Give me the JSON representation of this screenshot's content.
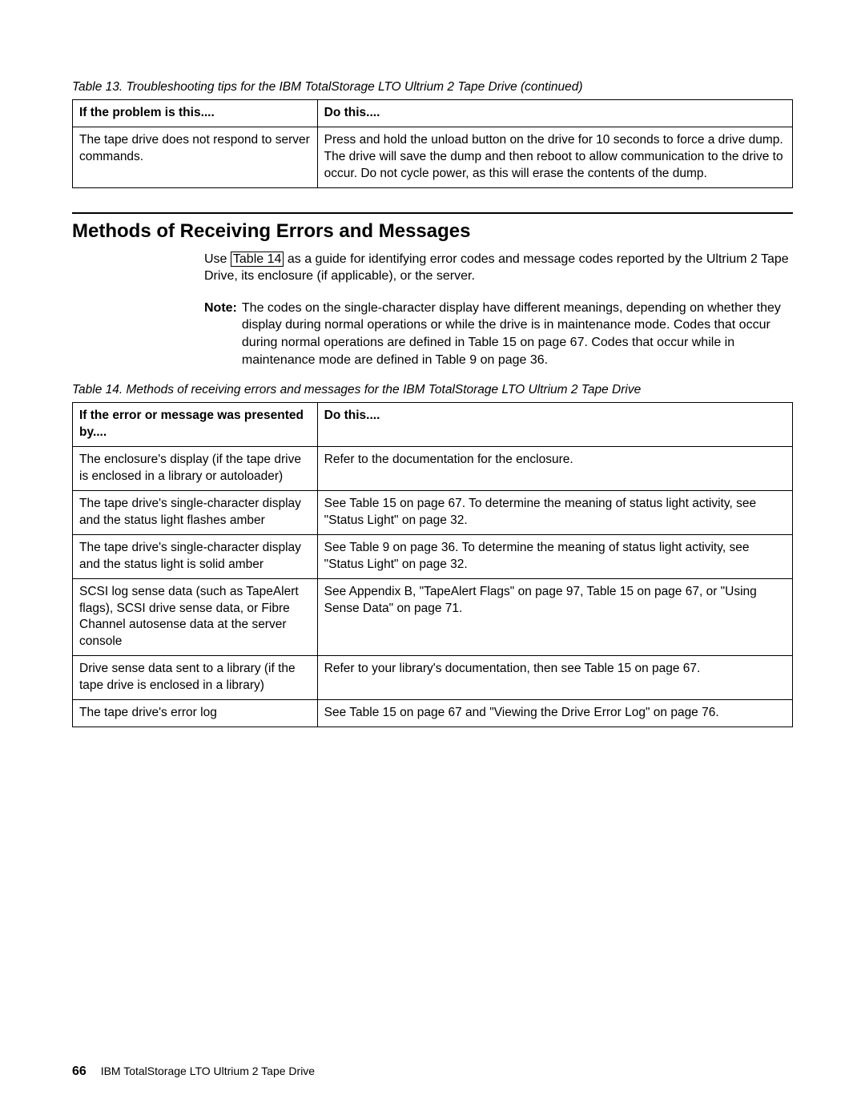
{
  "table13": {
    "caption": "Table 13. Troubleshooting tips for the IBM TotalStorage LTO Ultrium 2 Tape Drive  (continued)",
    "headers": {
      "c1": "If the problem is this....",
      "c2": "Do this...."
    },
    "rows": [
      {
        "c1": "The tape drive does not respond to server commands.",
        "c2": "Press and hold the unload button on the drive for 10 seconds to force a drive dump. The drive will save the dump and then reboot to allow communication to the drive to occur. Do not cycle power, as this will erase the contents of the dump."
      }
    ]
  },
  "section": {
    "heading": "Methods of Receiving Errors and Messages",
    "para_before_link": "Use ",
    "link_text": "Table 14",
    "para_after_link": " as a guide for identifying error codes and message codes reported by the Ultrium 2 Tape Drive, its enclosure (if applicable), or the server.",
    "note_label": "Note:",
    "note_body": "The codes on the single-character display have different meanings, depending on whether they display during normal operations or while the drive is in maintenance mode. Codes that occur during normal operations are defined in Table 15 on page 67. Codes that occur while in maintenance mode are defined in Table 9 on page 36."
  },
  "table14": {
    "caption": "Table 14. Methods of receiving errors and messages for the IBM TotalStorage LTO Ultrium 2 Tape Drive",
    "headers": {
      "c1": "If the error or message was presented by....",
      "c2": "Do this...."
    },
    "rows": [
      {
        "c1": "The enclosure's display (if the tape drive is enclosed in a library or autoloader)",
        "c2": "Refer to the documentation for the enclosure."
      },
      {
        "c1": "The tape drive's single-character display and the status light flashes amber",
        "c2": "See Table 15 on page 67. To determine the meaning of status light activity, see \"Status Light\" on page 32."
      },
      {
        "c1": "The tape drive's single-character display and the status light is solid amber",
        "c2": "See Table 9 on page 36. To determine the meaning of status light activity, see \"Status Light\" on page 32."
      },
      {
        "c1": "SCSI log sense data (such as TapeAlert flags), SCSI drive sense data, or Fibre Channel autosense data at the server console",
        "c2": "See Appendix B, \"TapeAlert Flags\" on page 97, Table 15 on page 67, or \"Using Sense Data\" on page 71."
      },
      {
        "c1": "Drive sense data sent to a library (if the tape drive is enclosed in a library)",
        "c2": "Refer to your library's documentation, then see Table 15 on page 67."
      },
      {
        "c1": "The tape drive's error log",
        "c2": "See Table 15 on page 67 and \"Viewing the Drive Error Log\" on page 76."
      }
    ]
  },
  "footer": {
    "page_num": "66",
    "title": "IBM TotalStorage LTO Ultrium 2 Tape Drive"
  }
}
